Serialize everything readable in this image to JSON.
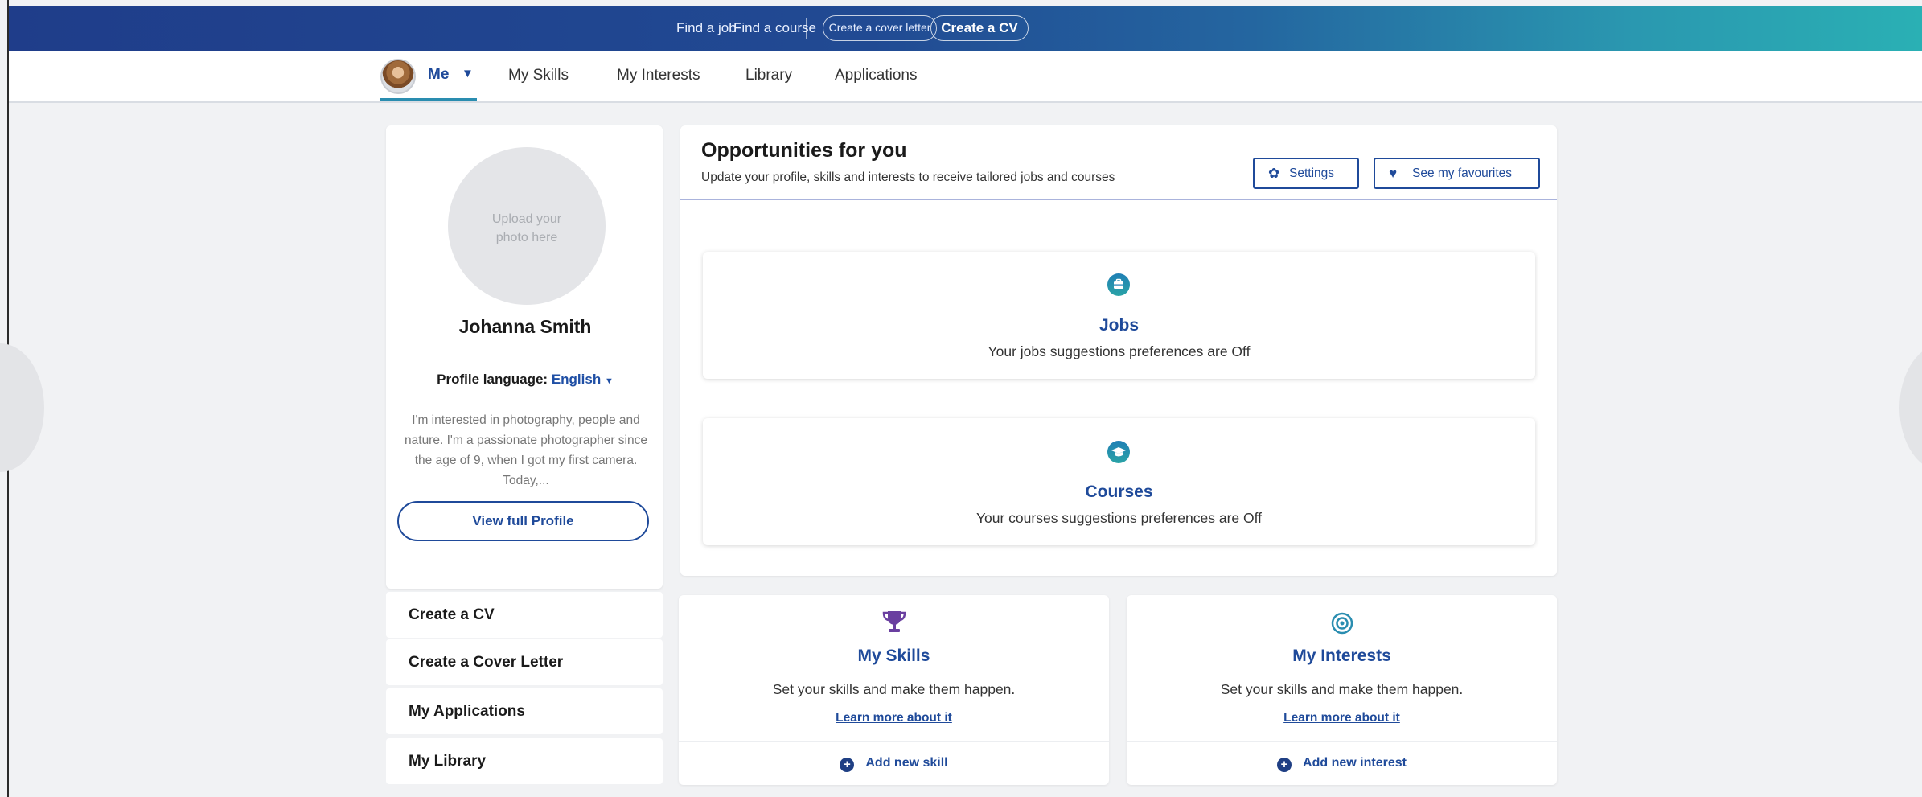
{
  "topbar": {
    "find_job": "Find a job",
    "find_course": "Find a course",
    "create_cover_letter": "Create a cover letter",
    "create_cv": "Create a CV"
  },
  "nav": {
    "me": "Me",
    "items": [
      "My Skills",
      "My Interests",
      "Library",
      "Applications"
    ]
  },
  "profile": {
    "photo_placeholder": "Upload your\nphoto here",
    "name": "Johanna Smith",
    "language_label": "Profile language:",
    "language_value": "English",
    "bio": "I'm interested in photography, people and nature. I'm a passionate photographer since the age of 9, when I got my first camera. Today,...",
    "view_button": "View full Profile"
  },
  "side_menu": [
    "Create a CV",
    "Create a Cover Letter",
    "My Applications",
    "My Library"
  ],
  "opportunities": {
    "title": "Opportunities for you",
    "subtitle": "Update your profile, skills and interests to receive tailored jobs and courses",
    "settings_button": "Settings",
    "favourites_button": "See my favourites",
    "jobs": {
      "title": "Jobs",
      "description": "Your jobs suggestions preferences are Off"
    },
    "courses": {
      "title": "Courses",
      "description": "Your courses suggestions preferences are Off"
    }
  },
  "skills_card": {
    "title": "My Skills",
    "description": "Set your skills and make them happen.",
    "learn_more": "Learn more about it",
    "add": "Add new skill"
  },
  "interests_card": {
    "title": "My Interests",
    "description": "Set your skills and make them happen.",
    "learn_more": "Learn more about it",
    "add": "Add new interest"
  },
  "colors": {
    "brand_blue": "#1f4a9a",
    "teal": "#2a98b0",
    "trophy_purple": "#6a3fa0"
  }
}
